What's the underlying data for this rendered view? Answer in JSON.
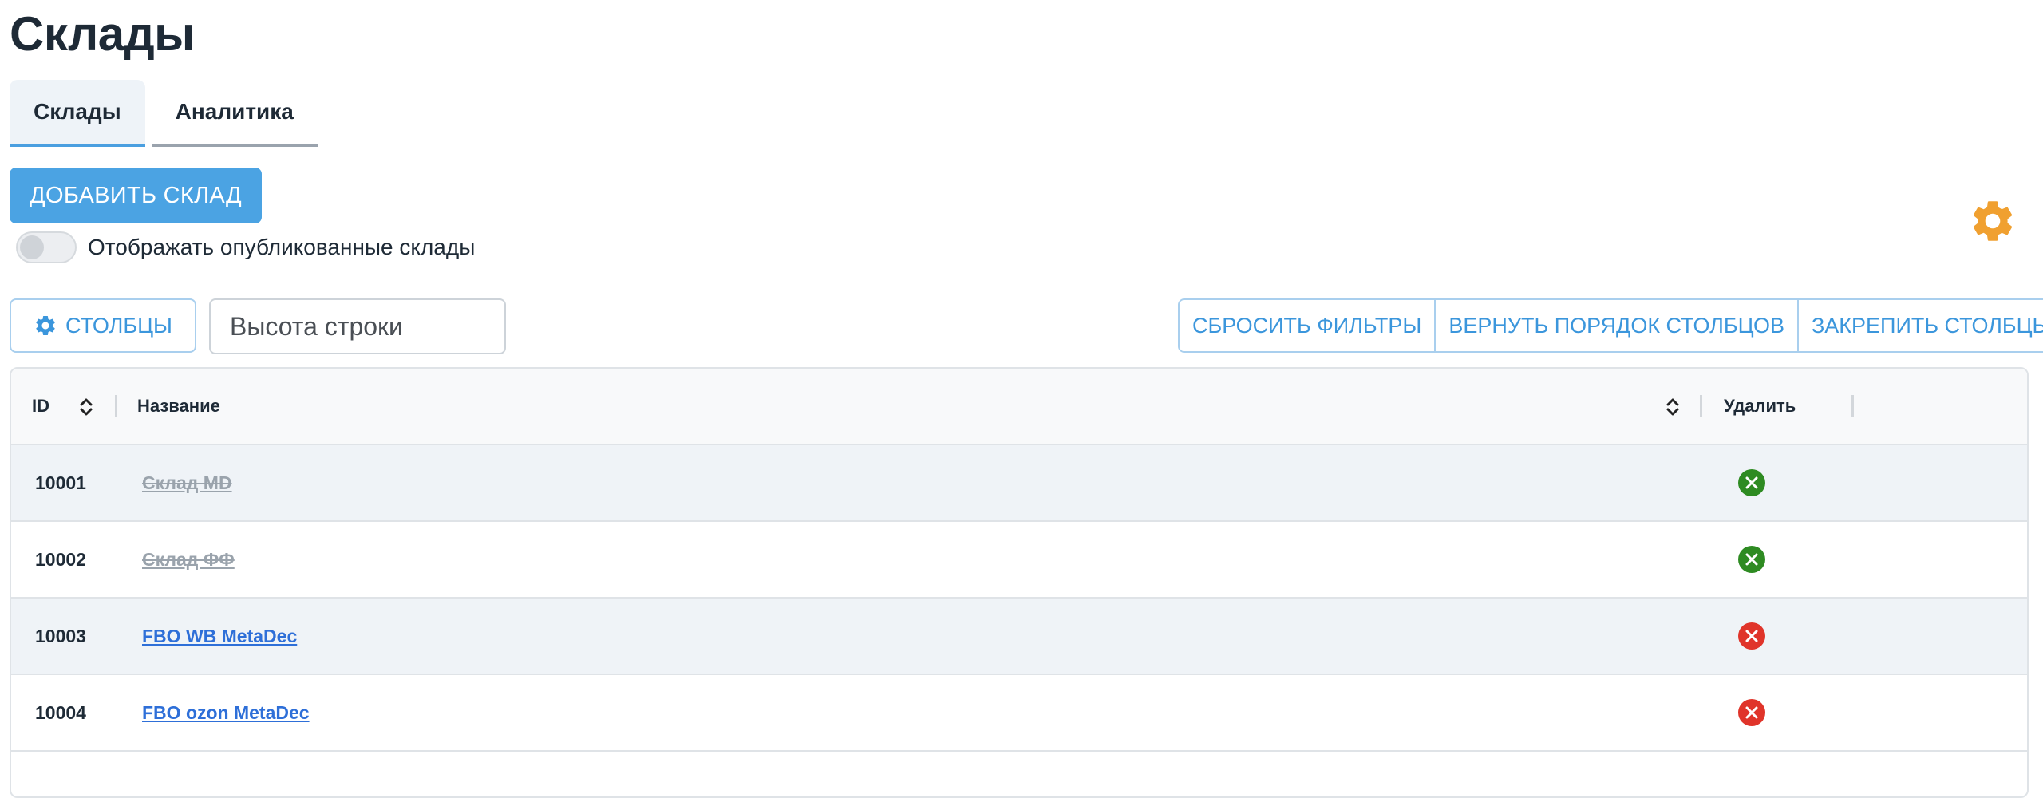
{
  "page": {
    "title": "Склады"
  },
  "tabs": [
    {
      "label": "Склады",
      "active": true
    },
    {
      "label": "Аналитика",
      "active": false
    }
  ],
  "actions": {
    "add_warehouse_label": "ДОБАВИТЬ СКЛАД"
  },
  "toggle": {
    "label": "Отображать опубликованные склады",
    "checked": false
  },
  "toolbar": {
    "columns_label": "СТОЛБЦЫ",
    "row_height_placeholder": "Высота строки",
    "reset_filters_label": "СБРОСИТЬ ФИЛЬТРЫ",
    "restore_order_label": "ВЕРНУТЬ ПОРЯДОК СТОЛБЦОВ",
    "pin_columns_label": "ЗАКРЕПИТЬ СТОЛБЦЫ"
  },
  "table": {
    "columns": {
      "id": "ID",
      "name": "Название",
      "delete": "Удалить"
    },
    "rows": [
      {
        "id": "10001",
        "name": "Склад МD",
        "published": false,
        "delete_status": "green"
      },
      {
        "id": "10002",
        "name": "Склад ФФ",
        "published": false,
        "delete_status": "green"
      },
      {
        "id": "10003",
        "name": "FBO WB MetaDec",
        "published": true,
        "delete_status": "red"
      },
      {
        "id": "10004",
        "name": "FBO ozon MetaDec",
        "published": true,
        "delete_status": "red"
      }
    ]
  },
  "colors": {
    "accent": "#4ba3e3",
    "settings_gear": "#f0a030",
    "delete_green": "#2e8b22",
    "delete_red": "#e0342a"
  },
  "icons": {
    "settings": "gear-icon",
    "columns": "gear-icon",
    "sort": "sort-icon",
    "delete_green": "close-circle-icon",
    "delete_red": "close-circle-icon"
  }
}
